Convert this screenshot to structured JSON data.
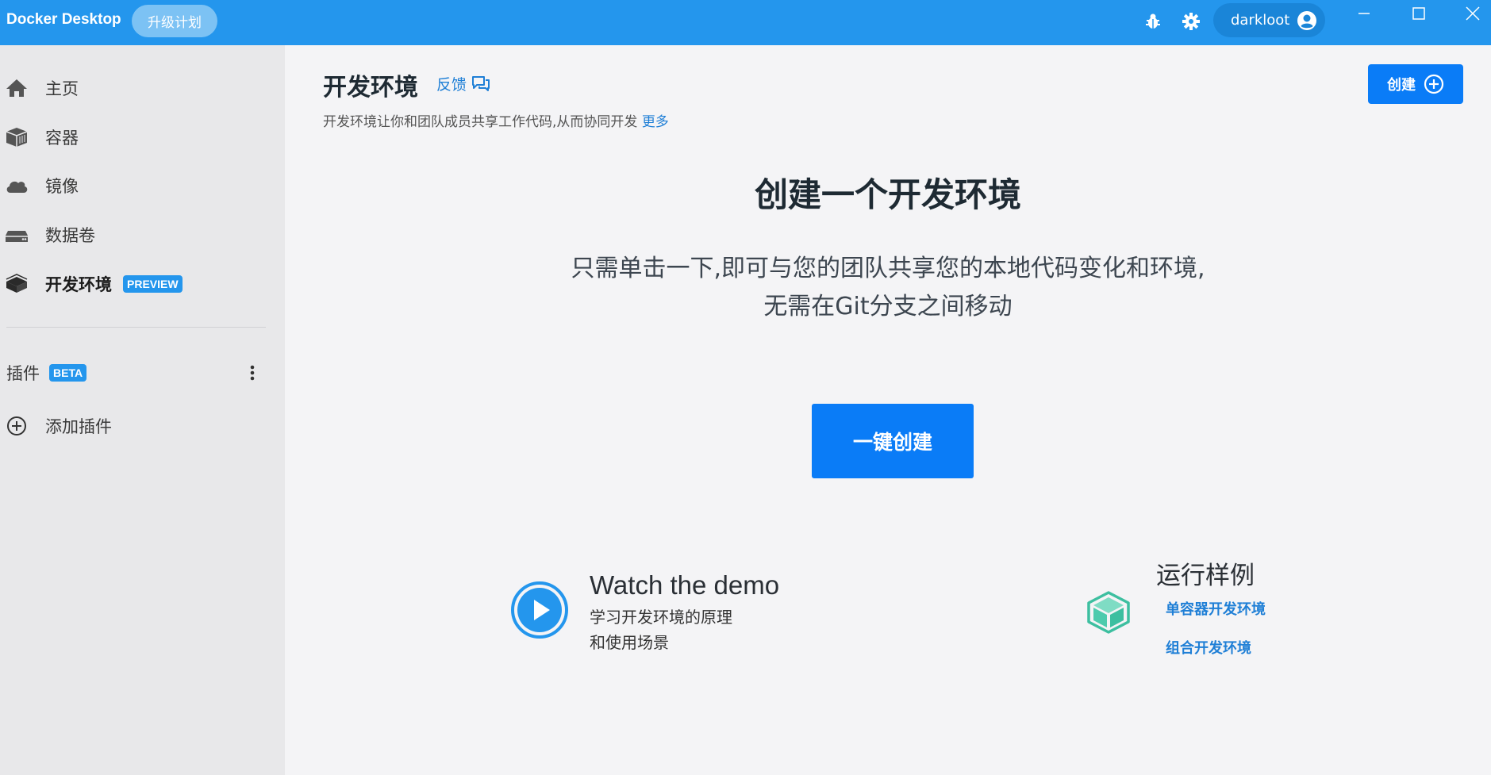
{
  "titlebar": {
    "app_title": "Docker Desktop",
    "upgrade_label": "升级计划",
    "username": "darkloot",
    "icons": [
      "bug-icon",
      "gear-icon",
      "user-avatar-icon",
      "minimize-icon",
      "maximize-icon",
      "close-icon"
    ],
    "bg_color": "#2496ed"
  },
  "sidebar": {
    "items": [
      {
        "label": "主页",
        "icon": "home-icon"
      },
      {
        "label": "容器",
        "icon": "container-icon"
      },
      {
        "label": "镜像",
        "icon": "cloud-icon"
      },
      {
        "label": "数据卷",
        "icon": "volume-icon"
      },
      {
        "label": "开发环境",
        "icon": "dev-env-icon",
        "badge": "PREVIEW",
        "active": true
      }
    ],
    "extensions": {
      "label": "插件",
      "badge": "BETA",
      "add_label": "添加插件"
    }
  },
  "main": {
    "title": "开发环境",
    "feedback_label": "反馈",
    "subtitle": "开发环境让你和团队成员共享工作代码,从而协同开发",
    "more_label": "更多",
    "create_label": "创建",
    "hero_title": "创建一个开发环境",
    "hero_line1": "只需单击一下,即可与您的团队共享您的本地代码变化和环境,",
    "hero_line2": "无需在Git分支之间移动",
    "one_click_label": "一键创建",
    "demo": {
      "title": "Watch the demo",
      "line1": "学习开发环境的原理",
      "line2": "和使用场景"
    },
    "samples": {
      "title": "运行样例",
      "single": "单容器开发环境",
      "compose": "组合开发环境"
    },
    "accent_color": "#0a7cf7",
    "link_color": "#1f7fd6"
  }
}
